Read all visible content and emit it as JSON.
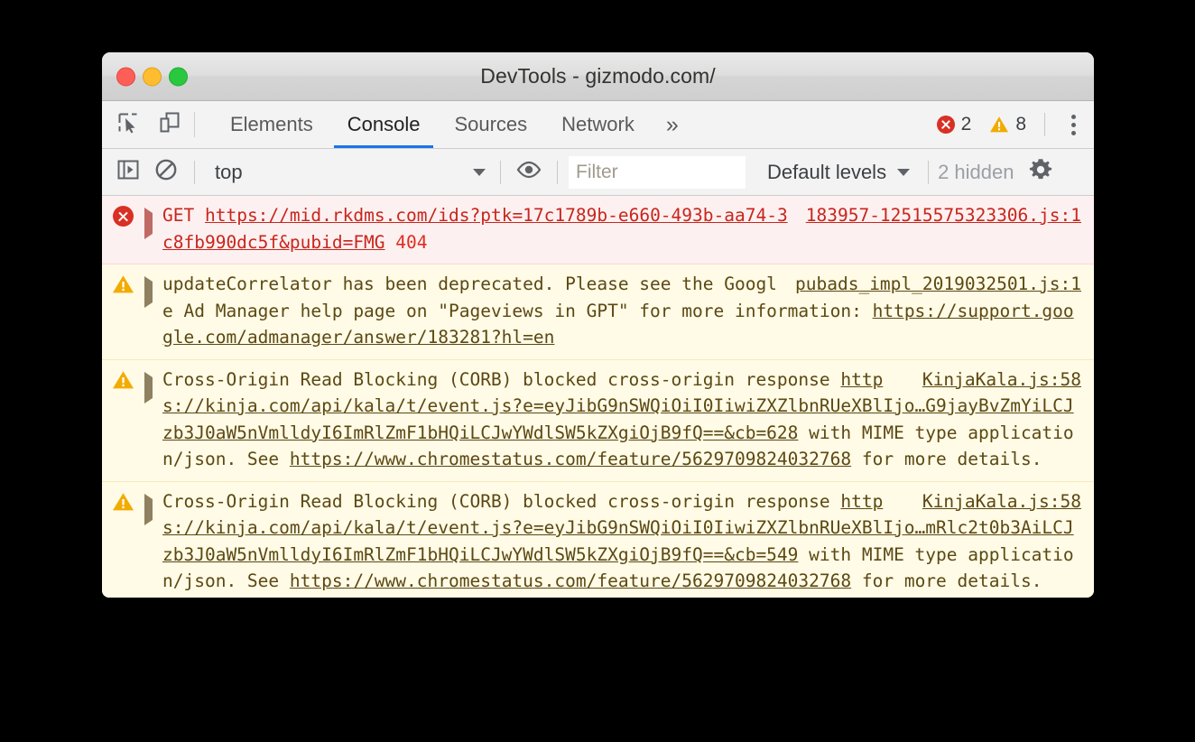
{
  "window": {
    "title": "DevTools - gizmodo.com/",
    "traffic_lights": [
      "close-red",
      "minimize-yellow",
      "zoom-green"
    ]
  },
  "tabbar": {
    "inspect_icon": "inspect-element-icon",
    "device_icon": "toggle-device-toolbar-icon",
    "tabs": [
      {
        "label": "Elements",
        "active": false
      },
      {
        "label": "Console",
        "active": true
      },
      {
        "label": "Sources",
        "active": false
      },
      {
        "label": "Network",
        "active": false
      }
    ],
    "more_tabs_label": "»",
    "error_count": "2",
    "warning_count": "8",
    "menu_icon": "kebab-menu-icon"
  },
  "toolbar": {
    "sidebar_icon": "show-console-sidebar-icon",
    "clear_icon": "clear-console-icon",
    "context_value": "top",
    "eye_icon": "live-expression-icon",
    "filter_placeholder": "Filter",
    "filter_value": "",
    "levels_label": "Default levels",
    "hidden_label": "2 hidden",
    "settings_icon": "settings-gear-icon"
  },
  "console": {
    "messages": [
      {
        "type": "error",
        "icon": "error-icon",
        "verb": "GET",
        "url": "https://mid.rkdms.com/ids?ptk=17c1789b-e660-493b-aa74-3c8fb990dc5f&pubid=FMG",
        "status": "404",
        "source": "183957-12515575323306.js:1"
      },
      {
        "type": "warning",
        "icon": "warning-icon",
        "text_before": "updateCorrelator has been deprecated. Please see the Google Ad Manager help page on \"Pageviews in GPT\" for more information: ",
        "link": "https://support.google.com/admanager/answer/183281?hl=en",
        "text_after": "",
        "source": "pubads_impl_2019032501.js:1"
      },
      {
        "type": "warning",
        "icon": "warning-icon",
        "text_before": "Cross-Origin Read Blocking (CORB) blocked cross-origin response ",
        "link": "https://kinja.com/api/kala/t/event.js?e=eyJibG9nSWQiOiI0IiwiZXZlbnRUeXBlIjo…G9jayBvZmYiLCJzb3J0aW5nVmlldyI6ImRlZmF1bHQiLCJwYWdlSW5kZXgiOjB9fQ==&cb=628",
        "text_middle": " with MIME type application/json. See ",
        "link2": "https://www.chromestatus.com/feature/5629709824032768",
        "text_after": " for more details.",
        "source": "KinjaKala.js:58"
      },
      {
        "type": "warning",
        "icon": "warning-icon",
        "text_before": "Cross-Origin Read Blocking (CORB) blocked cross-origin response ",
        "link": "https://kinja.com/api/kala/t/event.js?e=eyJibG9nSWQiOiI0IiwiZXZlbnRUeXBlIjo…mRlc2t0b3AiLCJzb3J0aW5nVmlldyI6ImRlZmF1bHQiLCJwYWdlSW5kZXgiOjB9fQ==&cb=549",
        "text_middle": " with MIME type application/json. See ",
        "link2": "https://www.chromestatus.com/feature/5629709824032768",
        "text_after": " for more details.",
        "source": "KinjaKala.js:58"
      }
    ]
  },
  "colors": {
    "accent_tab": "#1a73e8",
    "error_red": "#d93025",
    "warning_yellow": "#f2ab00",
    "error_bg": "#fdf0f0",
    "warning_bg": "#fffbe6",
    "error_text": "#c7261d",
    "warning_text": "#5c4813"
  }
}
